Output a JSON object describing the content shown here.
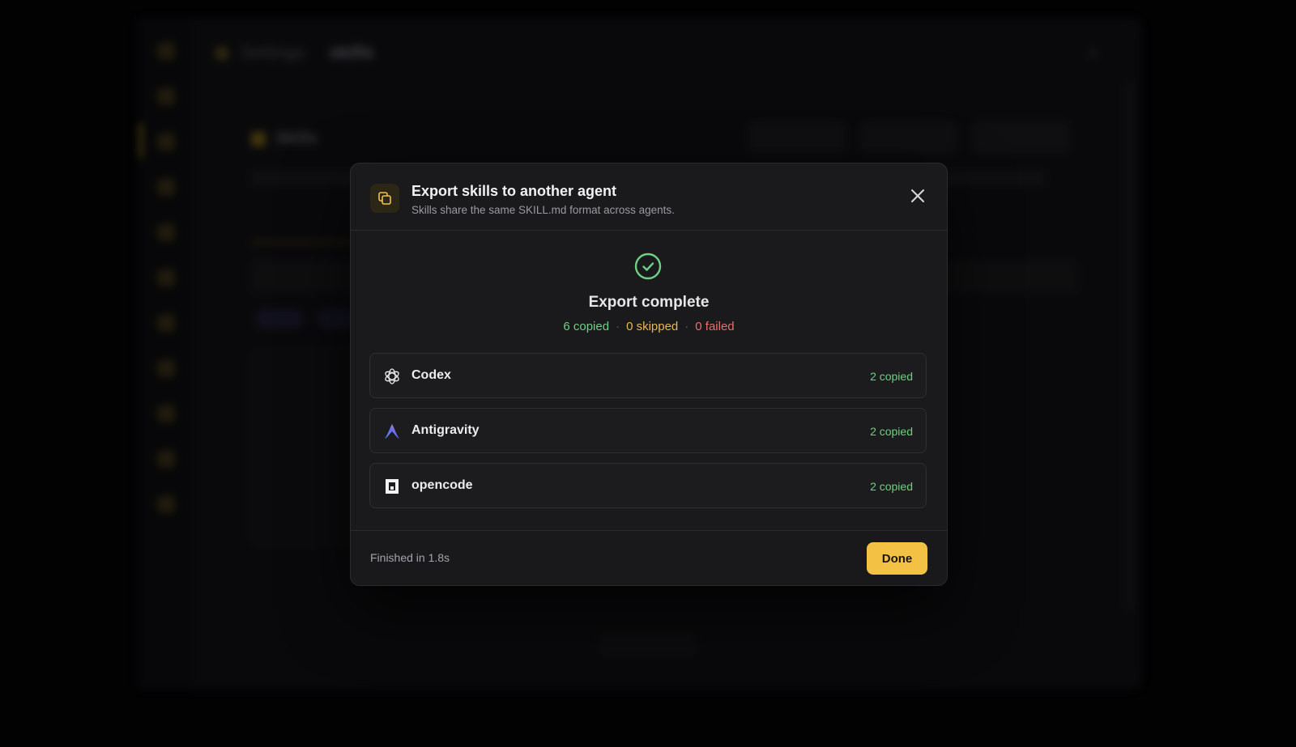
{
  "background": {
    "breadcrumb": {
      "root": "Settings",
      "current": "skills"
    },
    "section_title": "Skills"
  },
  "dialog": {
    "title": "Export skills to another agent",
    "subtitle": "Skills share the same SKILL.md format across agents.",
    "status": {
      "title": "Export complete",
      "copied": "6 copied",
      "skipped": "0 skipped",
      "failed": "0 failed",
      "separator": "·"
    },
    "agents": [
      {
        "name": "Codex",
        "result": "2 copied",
        "icon": "openai-logo-icon"
      },
      {
        "name": "Antigravity",
        "result": "2 copied",
        "icon": "antigravity-logo-icon"
      },
      {
        "name": "opencode",
        "result": "2 copied",
        "icon": "opencode-logo-icon"
      }
    ],
    "footer": {
      "elapsed": "Finished in 1.8s",
      "done_label": "Done"
    }
  },
  "colors": {
    "accent": "#f3c244",
    "success": "#6fcf82",
    "warning": "#e8b84a",
    "danger": "#e8706a",
    "surface": "#1a1a1d"
  }
}
